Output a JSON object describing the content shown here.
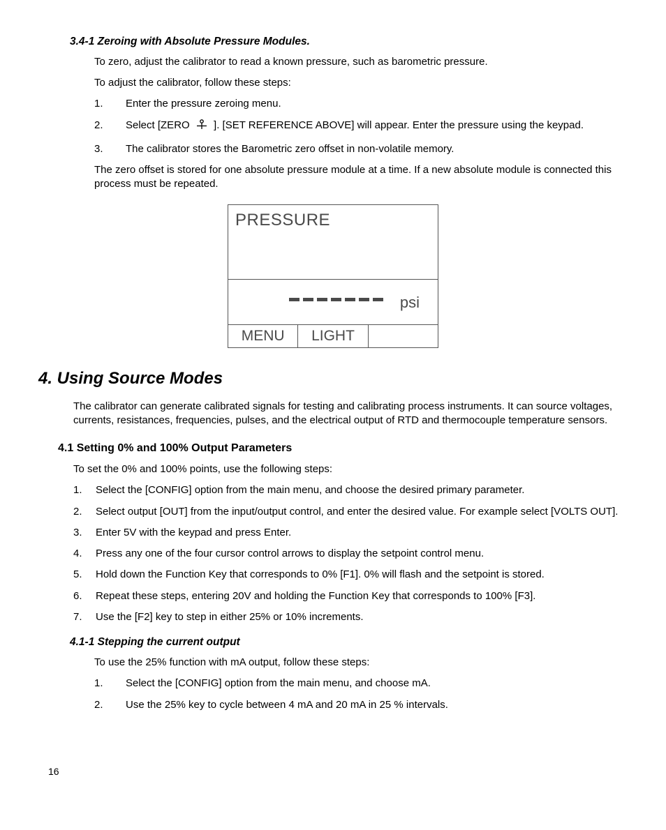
{
  "sec341": {
    "title": "3.4-1 Zeroing with Absolute Pressure Modules.",
    "p1": "To zero, adjust the calibrator to read a known pressure, such as barometric pressure.",
    "p2": "To adjust the calibrator, follow these steps:",
    "steps": [
      "Enter the pressure zeroing menu.",
      "Select [ZERO       ]. [SET REFERENCE ABOVE] will appear. Enter the pressure using the keypad.",
      "The calibrator stores the Barometric zero offset in non-volatile memory."
    ],
    "step2_prefix": "Select [ZERO ",
    "step2_suffix": " ]. [SET REFERENCE ABOVE] will appear. Enter the pressure using the keypad.",
    "p3": "The zero offset is stored for one absolute pressure module at a time. If a new absolute module is connected this process must be repeated."
  },
  "display": {
    "title": "PRESSURE",
    "unit": "psi",
    "soft1": "MENU",
    "soft2": "LIGHT",
    "soft3": ""
  },
  "sec4": {
    "title": "4. Using Source Modes",
    "p1": "The calibrator can generate calibrated signals for testing and calibrating process instruments. It can source voltages, currents, resistances, frequencies, pulses, and the electrical output of RTD and thermocouple temperature sensors."
  },
  "sec41": {
    "title": "4.1 Setting 0% and 100% Output Parameters",
    "p1": "To set the 0% and 100% points, use the following steps:",
    "steps": [
      "Select the [CONFIG] option from the main menu, and choose the desired primary parameter.",
      "Select output [OUT] from the input/output control, and enter the desired value. For example select [VOLTS OUT].",
      "Enter 5V with the keypad and press Enter.",
      "Press any one of the four cursor control arrows to display the setpoint control menu.",
      "Hold down the Function Key that corresponds to 0% [F1]. 0% will flash and the setpoint is stored.",
      "Repeat these steps, entering 20V and holding the Function Key that corresponds to 100% [F3].",
      "Use the [F2] key to step in either 25% or 10% increments."
    ]
  },
  "sec411": {
    "title": "4.1-1 Stepping the current output",
    "p1": "To use the 25% function with mA output, follow these steps:",
    "steps": [
      "Select the [CONFIG] option from the main menu, and choose mA.",
      "Use the 25% key to cycle between 4 mA and 20 mA in 25 % intervals."
    ]
  },
  "page_number": "16"
}
